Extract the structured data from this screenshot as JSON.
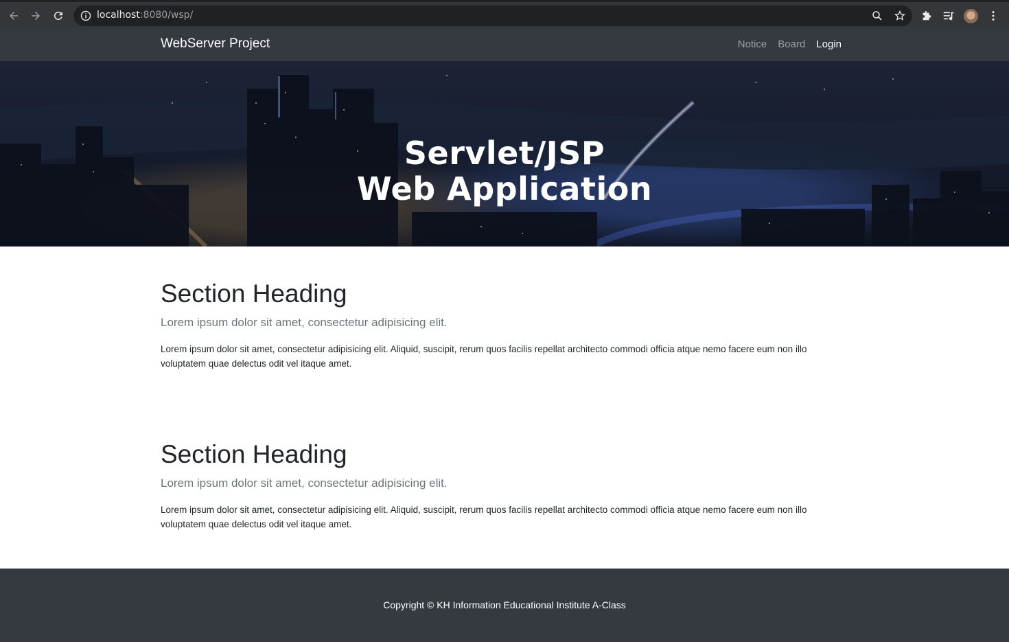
{
  "browser": {
    "url_host": "localhost",
    "url_rest": ":8080/wsp/"
  },
  "navbar": {
    "brand": "WebServer Project",
    "links": [
      "Notice",
      "Board",
      "Login"
    ]
  },
  "hero": {
    "line1": "Servlet/JSP",
    "line2": "Web Application"
  },
  "sections": [
    {
      "heading": "Section Heading",
      "lead": "Lorem ipsum dolor sit amet, consectetur adipisicing elit.",
      "body": "Lorem ipsum dolor sit amet, consectetur adipisicing elit. Aliquid, suscipit, rerum quos facilis repellat architecto commodi officia atque nemo facere eum non illo voluptatem quae delectus odit vel itaque amet."
    },
    {
      "heading": "Section Heading",
      "lead": "Lorem ipsum dolor sit amet, consectetur adipisicing elit.",
      "body": "Lorem ipsum dolor sit amet, consectetur adipisicing elit. Aliquid, suscipit, rerum quos facilis repellat architecto commodi officia atque nemo facere eum non illo voluptatem quae delectus odit vel itaque amet."
    }
  ],
  "footer": {
    "copyright": "Copyright © KH Information Educational Institute A-Class"
  },
  "colors": {
    "navbar_bg": "#343a40",
    "footer_bg": "#343a40",
    "heading_text": "#212529",
    "lead_text": "#6c757d"
  },
  "icons": [
    "back-arrow-icon",
    "forward-arrow-icon",
    "reload-icon",
    "info-icon",
    "zoom-icon",
    "star-icon",
    "extensions-icon",
    "reading-list-icon",
    "menu-dots-icon"
  ]
}
